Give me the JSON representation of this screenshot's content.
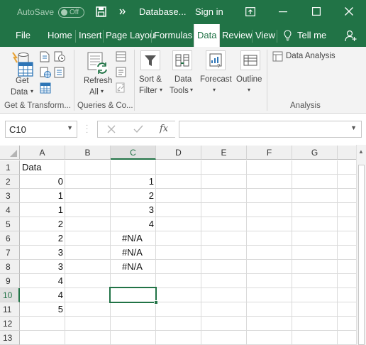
{
  "titlebar": {
    "autosave_label": "AutoSave",
    "autosave_state": "Off",
    "document_name": "Database...",
    "signin_label": "Sign in"
  },
  "tabs": [
    "File",
    "Home",
    "Insert",
    "Page Layou",
    "Formulas",
    "Data",
    "Review",
    "View"
  ],
  "active_tab": "Data",
  "tell_me": "Tell me",
  "ribbon": {
    "get_data": [
      "Get",
      "Data"
    ],
    "refresh_all": [
      "Refresh",
      "All"
    ],
    "sort_filter": [
      "Sort &",
      "Filter"
    ],
    "data_tools": [
      "Data",
      "Tools"
    ],
    "forecast": "Forecast",
    "outline": "Outline",
    "data_analysis": "Data Analysis",
    "groups": {
      "get_transform": "Get & Transform...",
      "queries": "Queries & Co...",
      "analysis": "Analysis"
    }
  },
  "formula_bar": {
    "name_box": "C10",
    "fx": "fx",
    "formula": ""
  },
  "sheet": {
    "columns": [
      "A",
      "B",
      "C",
      "D",
      "E",
      "F",
      "G"
    ],
    "rows": [
      "1",
      "2",
      "3",
      "4",
      "5",
      "6",
      "7",
      "8",
      "9",
      "10",
      "11",
      "12",
      "13"
    ],
    "column_a": [
      "Data",
      "0",
      "1",
      "1",
      "2",
      "2",
      "3",
      "3",
      "4",
      "4",
      "5",
      "",
      ""
    ],
    "column_c": [
      "",
      "1",
      "2",
      "3",
      "4",
      "#N/A",
      "#N/A",
      "#N/A",
      "",
      "",
      "",
      "",
      ""
    ],
    "selected_cell": "C10"
  },
  "colors": {
    "brand": "#217346",
    "ribbon_bg": "#f3f3f3",
    "grid_line": "#dadada"
  }
}
